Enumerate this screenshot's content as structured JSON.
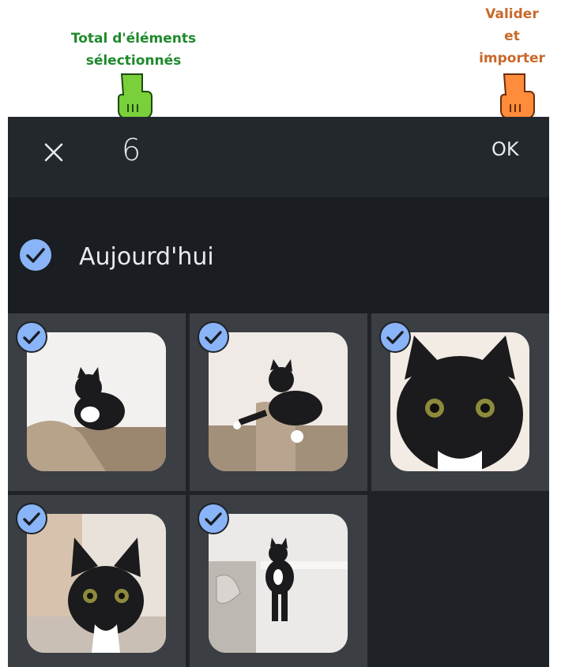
{
  "annotations": {
    "total_label": "Total d'éléments\nsélectionnés",
    "total_line1": "Total d'éléments",
    "total_line2": "sélectionnés",
    "ok_line1": "Valider",
    "ok_line2": "et",
    "ok_line3": "importer",
    "total_color": "#1f8a2c",
    "ok_color": "#c8692b"
  },
  "topbar": {
    "close_icon": "close-icon",
    "selected_count": "6",
    "ok_label": "OK"
  },
  "section": {
    "title": "Aujourd'hui",
    "check_icon": "check-circle-icon"
  },
  "photos": [
    {
      "label": "cat-photo",
      "selected": true
    },
    {
      "label": "cat-photo",
      "selected": true
    },
    {
      "label": "cat-photo",
      "selected": true
    },
    {
      "label": "cat-photo",
      "selected": true
    },
    {
      "label": "cat-photo",
      "selected": true
    }
  ],
  "colors": {
    "accent_check": "#8ab4f8",
    "background": "#1f2327",
    "tile": "#3b3f44"
  }
}
